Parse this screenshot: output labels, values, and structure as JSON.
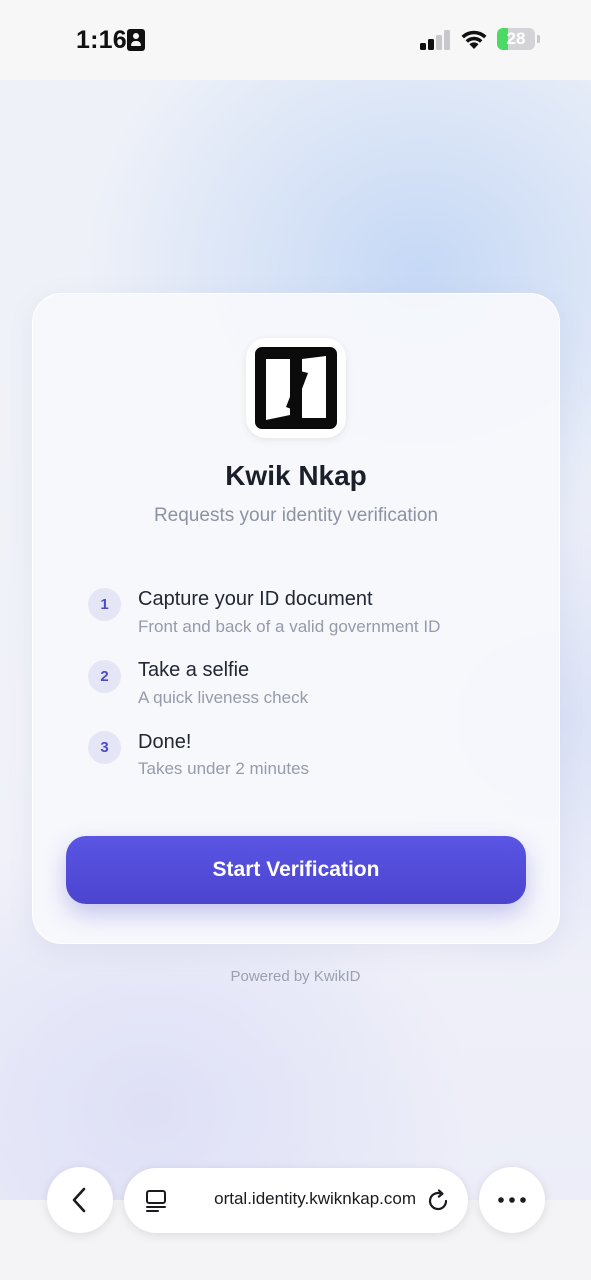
{
  "status_bar": {
    "time": "1:16",
    "battery_level": "28",
    "battery_percent": 28,
    "signal_bars_active": 2,
    "signal_bars_total": 4
  },
  "card": {
    "app_name": "Kwik Nkap",
    "subtitle": "Requests your identity verification",
    "steps": [
      {
        "number": "1",
        "title": "Capture your ID document",
        "description": "Front and back of a valid government ID"
      },
      {
        "number": "2",
        "title": "Take a selfie",
        "description": "A quick liveness check"
      },
      {
        "number": "3",
        "title": "Done!",
        "description": "Takes under 2 minutes"
      }
    ],
    "start_button_label": "Start Verification"
  },
  "footer": {
    "powered_by": "Powered by KwikID"
  },
  "browser": {
    "url_display": "ortal.identity.kwiknkap.com"
  },
  "colors": {
    "accent": "#4f4ad8",
    "step_badge_bg": "#e4e6f6",
    "battery_green": "#4cd964"
  }
}
